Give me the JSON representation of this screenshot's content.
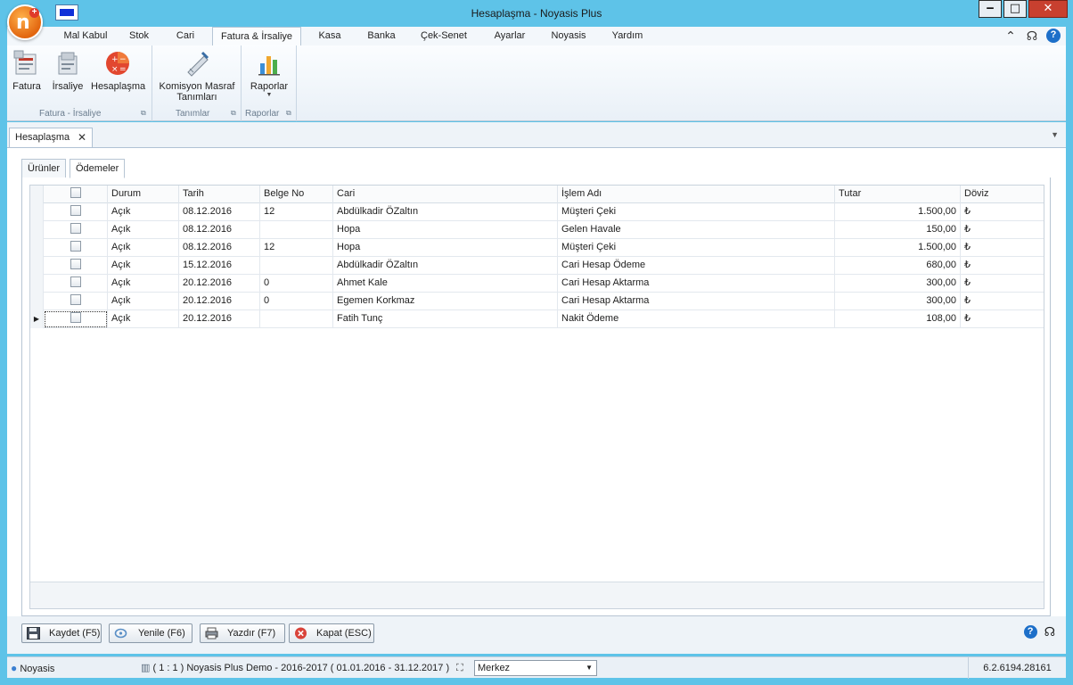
{
  "window": {
    "title": "Hesaplaşma - Noyasis Plus"
  },
  "menu": {
    "tabs": [
      {
        "label": "Mal Kabul",
        "active": false
      },
      {
        "label": "Stok",
        "active": false
      },
      {
        "label": "Cari",
        "active": false
      },
      {
        "label": "Fatura & İrsaliye",
        "active": true
      },
      {
        "label": "Kasa",
        "active": false
      },
      {
        "label": "Banka",
        "active": false
      },
      {
        "label": "Çek-Senet",
        "active": false
      },
      {
        "label": "Ayarlar",
        "active": false
      },
      {
        "label": "Noyasis",
        "active": false
      },
      {
        "label": "Yardım",
        "active": false
      }
    ],
    "help_label": "?"
  },
  "ribbon": {
    "groups": [
      {
        "label": "Fatura - İrsaliye",
        "buttons": [
          "Fatura",
          "İrsaliye",
          "Hesaplaşma"
        ]
      },
      {
        "label": "Tanımlar",
        "buttons": [
          "Komisyon Masraf Tanımları"
        ]
      },
      {
        "label": "Raporlar",
        "buttons": [
          "Raporlar"
        ]
      }
    ],
    "komisyon_line1": "Komisyon Masraf",
    "komisyon_line2": "Tanımları"
  },
  "doc_tab": {
    "label": "Hesaplaşma",
    "close": "✕"
  },
  "sub_tabs": [
    {
      "label": "Ürünler",
      "active": false
    },
    {
      "label": "Ödemeler",
      "active": true
    }
  ],
  "grid": {
    "columns": [
      "Durum",
      "Tarih",
      "Belge No",
      "Cari",
      "İşlem Adı",
      "Tutar",
      "Döviz"
    ],
    "rows": [
      {
        "durum": "Açık",
        "tarih": "08.12.2016",
        "belge": "12",
        "cari": "Abdülkadir ÖZaltın",
        "islem": "Müşteri Çeki",
        "tutar": "1.500,00",
        "doviz": "₺"
      },
      {
        "durum": "Açık",
        "tarih": "08.12.2016",
        "belge": "",
        "cari": "Hopa",
        "islem": "Gelen Havale",
        "tutar": "150,00",
        "doviz": "₺"
      },
      {
        "durum": "Açık",
        "tarih": "08.12.2016",
        "belge": "12",
        "cari": "Hopa",
        "islem": "Müşteri Çeki",
        "tutar": "1.500,00",
        "doviz": "₺"
      },
      {
        "durum": "Açık",
        "tarih": "15.12.2016",
        "belge": "",
        "cari": "Abdülkadir ÖZaltın",
        "islem": "Cari Hesap Ödeme",
        "tutar": "680,00",
        "doviz": "₺"
      },
      {
        "durum": "Açık",
        "tarih": "20.12.2016",
        "belge": "0",
        "cari": "Ahmet Kale",
        "islem": "Cari Hesap Aktarma",
        "tutar": "300,00",
        "doviz": "₺"
      },
      {
        "durum": "Açık",
        "tarih": "20.12.2016",
        "belge": "0",
        "cari": "Egemen Korkmaz",
        "islem": "Cari Hesap Aktarma",
        "tutar": "300,00",
        "doviz": "₺"
      },
      {
        "durum": "Açık",
        "tarih": "20.12.2016",
        "belge": "",
        "cari": "Fatih Tunç",
        "islem": "Nakit Ödeme",
        "tutar": "108,00",
        "doviz": "₺"
      }
    ]
  },
  "actions": {
    "save": "Kaydet (F5)",
    "refresh": "Yenile (F6)",
    "print": "Yazdır (F7)",
    "close": "Kapat (ESC)"
  },
  "status": {
    "user": "Noyasis",
    "company": "( 1 : 1 )  Noyasis Plus Demo - 2016-2017  ( 01.01.2016 - 31.12.2017 )",
    "branch": "Merkez",
    "version": "6.2.6194.28161"
  },
  "colors": {
    "frame": "#5ec3e8",
    "accent_orange": "#e2660f",
    "close_red": "#c8402f"
  }
}
